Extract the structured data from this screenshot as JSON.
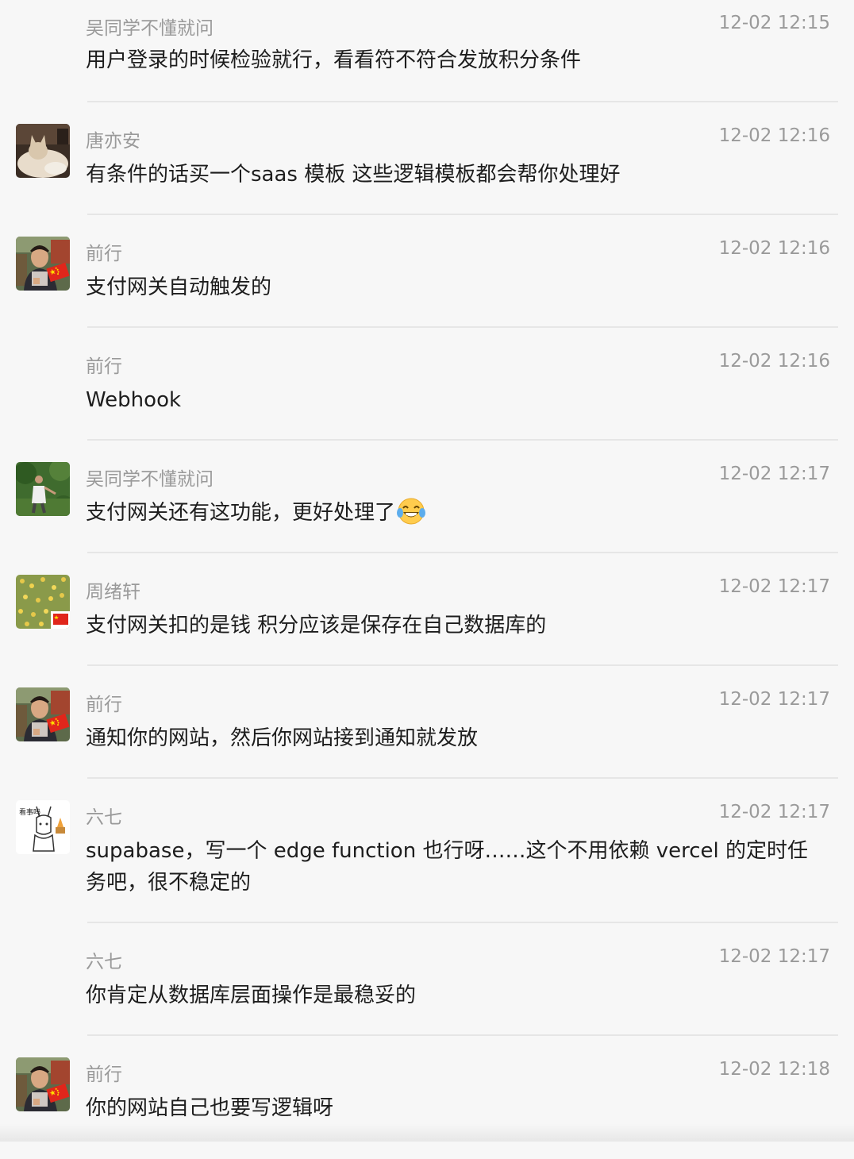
{
  "messages": [
    {
      "name": "吴同学不懂就问",
      "time": "12-02 12:15",
      "text": "用户登录的时候检验就行，看看符不符合发放积分条件",
      "avatar": "none"
    },
    {
      "name": "唐亦安",
      "time": "12-02 12:16",
      "text": "有条件的话买一个saas 模板 这些逻辑模板都会帮你处理好",
      "avatar": "cat-photo"
    },
    {
      "name": "前行",
      "time": "12-02 12:16",
      "text": "支付网关自动触发的",
      "avatar": "person-flag"
    },
    {
      "name": "前行",
      "time": "12-02 12:16",
      "text": "Webhook",
      "avatar": "none"
    },
    {
      "name": "吴同学不懂就问",
      "time": "12-02 12:17",
      "text": "支付网关还有这功能，更好处理了",
      "avatar": "garden-photo",
      "emoji": "tears-of-joy-icon"
    },
    {
      "name": "周绪轩",
      "time": "12-02 12:17",
      "text": "支付网关扣的是钱 积分应该是保存在自己数据库的",
      "avatar": "flower-field-flag"
    },
    {
      "name": "前行",
      "time": "12-02 12:17",
      "text": "通知你的网站，然后你网站接到通知就发放",
      "avatar": "person-flag"
    },
    {
      "name": "六七",
      "time": "12-02 12:17",
      "text": "supabase，写一个 edge function 也行呀……这个不用依赖 vercel 的定时任务吧，很不稳定的",
      "avatar": "cartoon-sketch"
    },
    {
      "name": "六七",
      "time": "12-02 12:17",
      "text": "你肯定从数据库层面操作是最稳妥的",
      "avatar": "none"
    },
    {
      "name": "前行",
      "time": "12-02 12:18",
      "text": "你的网站自己也要写逻辑呀",
      "avatar": "person-flag"
    }
  ],
  "avatar_sketch_text": "看事吗"
}
